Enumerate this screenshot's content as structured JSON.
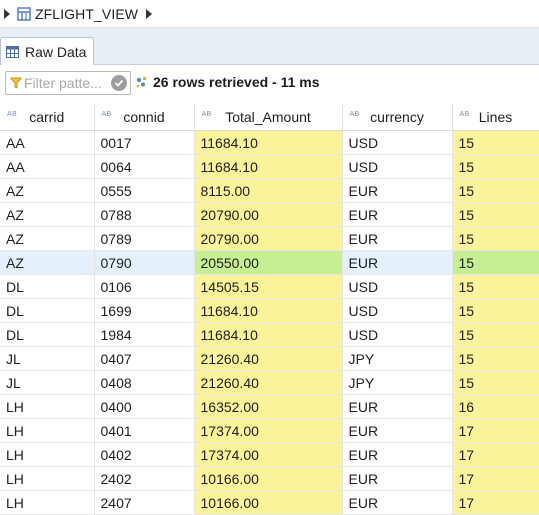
{
  "breadcrumb": {
    "view_name": "ZFLIGHT_VIEW",
    "icon": "view-icon"
  },
  "tab": {
    "label": "Raw Data",
    "icon": "grid-icon"
  },
  "toolbar": {
    "filter_placeholder": "Filter patte...",
    "status": "26 rows retrieved - 11 ms"
  },
  "colors": {
    "highlight": "#fbf39a",
    "selected_highlight": "#c6ee93",
    "selected_row": "#e4f0fb"
  },
  "table": {
    "type_badge": "AB",
    "columns": [
      "carrid",
      "connid",
      "Total_Amount",
      "currency",
      "Lines"
    ],
    "selected_row": 5,
    "rows": [
      [
        "AA",
        "0017",
        "11684.10",
        "USD",
        "15"
      ],
      [
        "AA",
        "0064",
        "11684.10",
        "USD",
        "15"
      ],
      [
        "AZ",
        "0555",
        "8115.00",
        "EUR",
        "15"
      ],
      [
        "AZ",
        "0788",
        "20790.00",
        "EUR",
        "15"
      ],
      [
        "AZ",
        "0789",
        "20790.00",
        "EUR",
        "15"
      ],
      [
        "AZ",
        "0790",
        "20550.00",
        "EUR",
        "15"
      ],
      [
        "DL",
        "0106",
        "14505.15",
        "USD",
        "15"
      ],
      [
        "DL",
        "1699",
        "11684.10",
        "USD",
        "15"
      ],
      [
        "DL",
        "1984",
        "11684.10",
        "USD",
        "15"
      ],
      [
        "JL",
        "0407",
        "21260.40",
        "JPY",
        "15"
      ],
      [
        "JL",
        "0408",
        "21260.40",
        "JPY",
        "15"
      ],
      [
        "LH",
        "0400",
        "16352.00",
        "EUR",
        "16"
      ],
      [
        "LH",
        "0401",
        "17374.00",
        "EUR",
        "17"
      ],
      [
        "LH",
        "0402",
        "17374.00",
        "EUR",
        "17"
      ],
      [
        "LH",
        "2402",
        "10166.00",
        "EUR",
        "17"
      ],
      [
        "LH",
        "2407",
        "10166.00",
        "EUR",
        "17"
      ]
    ]
  }
}
